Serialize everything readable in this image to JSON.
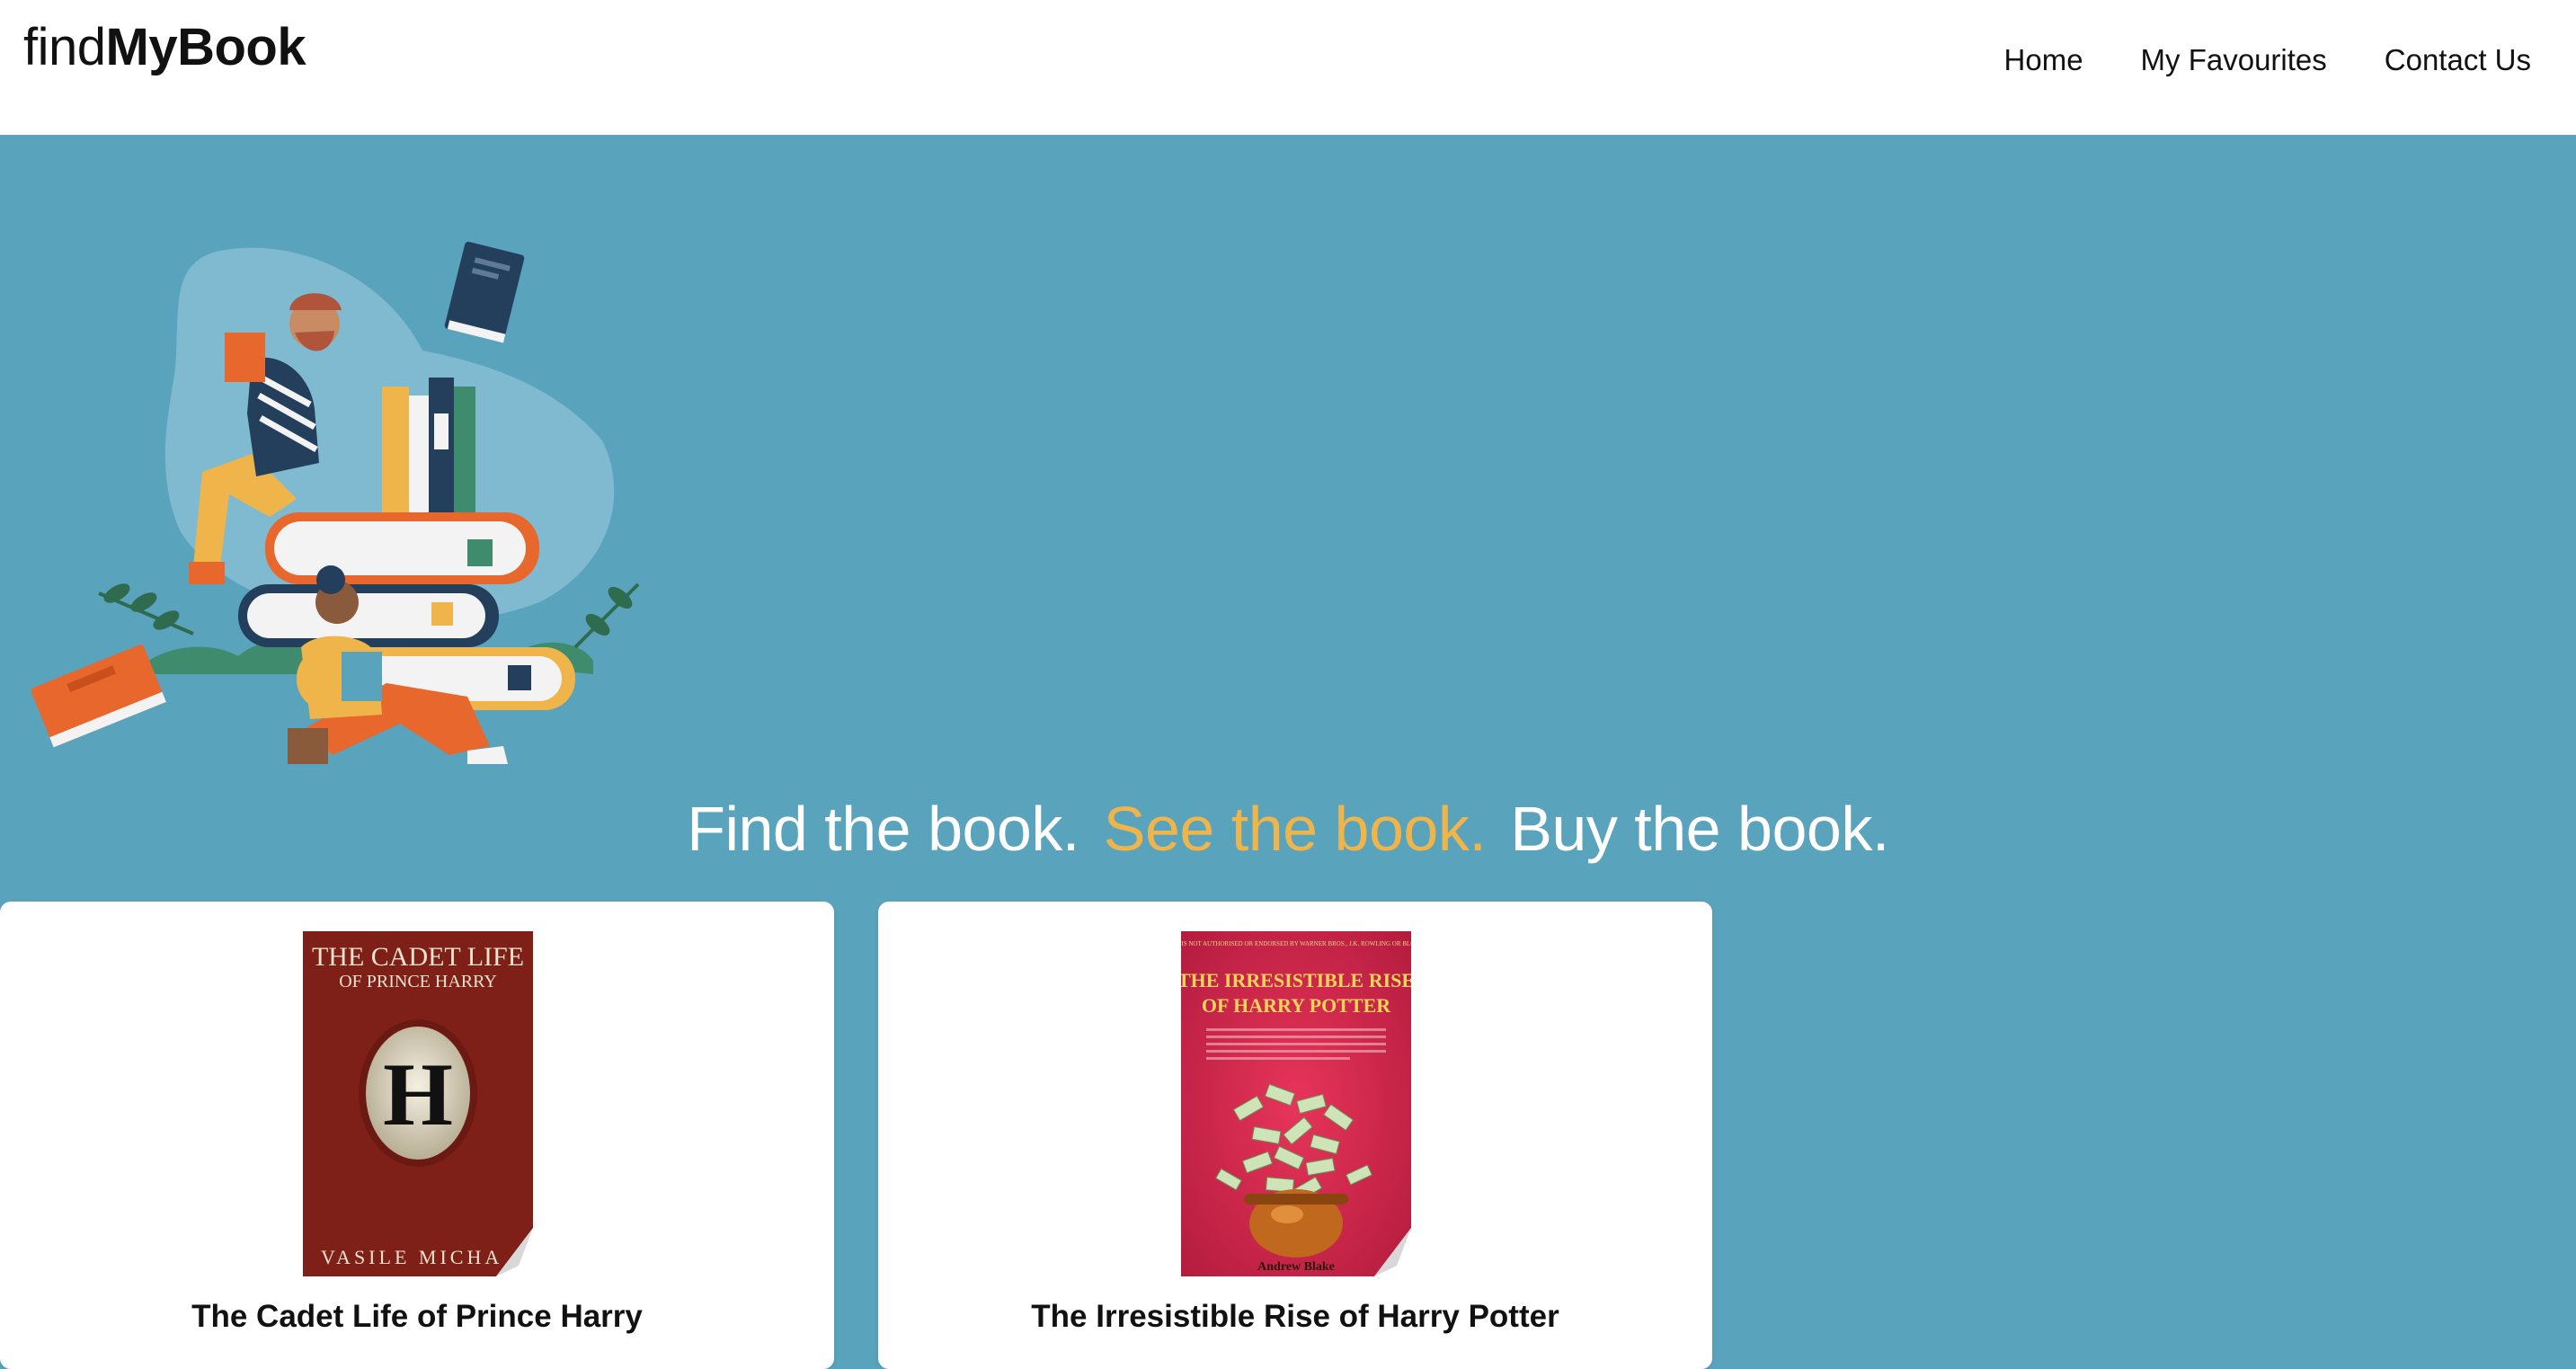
{
  "app": {
    "logo_light": "find",
    "logo_bold": "MyBook"
  },
  "nav": {
    "items": [
      "Home",
      "My Favourites",
      "Contact Us"
    ]
  },
  "hero": {
    "tagline_part1": "Find the book.",
    "tagline_part2": "See the book.",
    "tagline_part3": "Buy the book.",
    "accent_color": "#efb54b",
    "background_color": "#5aa3bc"
  },
  "books": [
    {
      "title": "The Cadet Life of Prince Harry",
      "cover_title_line1": "THE CADET LIFE",
      "cover_title_line2": "OF PRINCE HARRY",
      "cover_letter": "H",
      "cover_author": "VASILE MICHA"
    },
    {
      "title": "The Irresistible Rise of Harry Potter",
      "cover_top_text": "THIS BOOK IS NOT AUTHORISED OR ENDORSED BY WARNER BROS., J.K. ROWLING OR BLOOMSBURY",
      "cover_title_line1": "THE IRRESISTIBLE RISE",
      "cover_title_line2": "OF HARRY POTTER",
      "cover_author": "Andrew Blake"
    }
  ]
}
